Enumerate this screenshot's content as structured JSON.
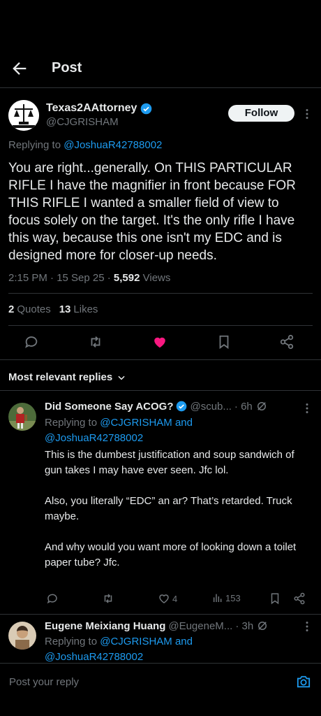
{
  "header": {
    "title": "Post"
  },
  "post": {
    "author_name": "Texas2AAttorney",
    "author_handle": "@CJGRISHAM",
    "follow_label": "Follow",
    "replying_prefix": "Replying to",
    "replying_to": "@JoshuaR42788002",
    "text": "You are right...generally.  On THIS PARTICULAR RIFLE I have the magnifier in front because FOR THIS RIFLE I wanted a smaller field of view to focus solely on the target.  It's the only rifle I have this way, because this one isn't my EDC and is designed more for closer-up needs.",
    "time": "2:15 PM · 15 Sep 25 · ",
    "views_count": "5,592",
    "views_label": " Views",
    "quotes_count": "2",
    "quotes_label": "Quotes",
    "likes_count": "13",
    "likes_label": "Likes",
    "liked": true
  },
  "replies_filter": "Most relevant replies",
  "replies": [
    {
      "name": "Did Someone Say ACOG?",
      "handle": "@scub...",
      "time": "· 6h",
      "replying_prefix": "Replying to ",
      "replying_to_1": "@CJGRISHAM",
      "replying_and": " and",
      "replying_to_2": "@JoshuaR42788002",
      "para1": "This is the dumbest justification and soup sandwich of gun takes I may have ever seen.  Jfc lol.",
      "para2": "Also, you literally “EDC” an ar?  That’s retarded.  Truck maybe.",
      "para3": "And why would you want more of looking down a toilet paper tube?  Jfc.",
      "likes": "4",
      "views": "153"
    },
    {
      "name": "Eugene Meixiang Huang",
      "handle": "@EugeneM...",
      "time": "· 3h",
      "replying_prefix": "Replying to ",
      "replying_to_1": "@CJGRISHAM",
      "replying_and": " and",
      "replying_to_2": "@JoshuaR42788002"
    }
  ],
  "compose": {
    "placeholder": "Post your reply"
  },
  "colors": {
    "accent": "#1d9bf0",
    "like": "#f91880",
    "background": "#000000"
  },
  "icons": [
    "back-arrow-icon",
    "verified-icon",
    "more-icon",
    "reply-icon",
    "repost-icon",
    "heart-icon",
    "bookmark-icon",
    "share-icon",
    "chevron-down-icon",
    "grok-icon",
    "views-icon",
    "camera-icon"
  ]
}
